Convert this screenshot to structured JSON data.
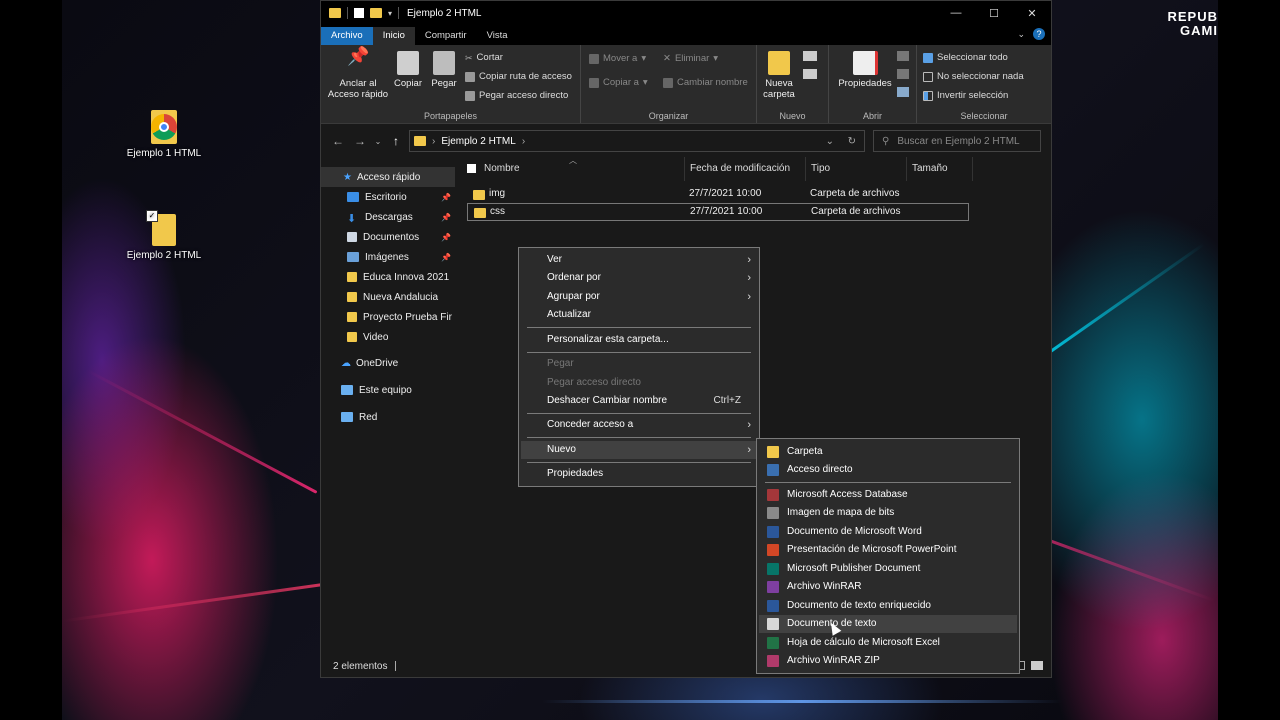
{
  "colors": {
    "accent": "#1a6fb9",
    "folder": "#f1c84b",
    "window_bg": "#191919",
    "ribbon_bg": "#2b2b2b",
    "menu_bg": "#2b2b2b"
  },
  "wallpaper_brand": [
    "REPUB",
    "GAMI"
  ],
  "desktop_icons": [
    {
      "label": "Ejemplo 1 HTML",
      "icon": "chrome-icon"
    },
    {
      "label": "Ejemplo 2 HTML",
      "icon": "folder-icon"
    }
  ],
  "window": {
    "title": "Ejemplo 2 HTML",
    "controls": {
      "minimize": "—",
      "maximize": "☐",
      "close": "✕"
    }
  },
  "ribbon_tabs": [
    "Archivo",
    "Inicio",
    "Compartir",
    "Vista"
  ],
  "ribbon": {
    "portapapeles": {
      "label": "Portapapeles",
      "anclar": "Anclar al Acceso rápido",
      "copiar": "Copiar",
      "pegar": "Pegar",
      "cortar": "Cortar",
      "copiar_ruta": "Copiar ruta de acceso",
      "pegar_acceso": "Pegar acceso directo"
    },
    "organizar": {
      "label": "Organizar",
      "mover": "Mover a",
      "copiar_a": "Copiar a",
      "eliminar": "Eliminar",
      "cambiar_nombre": "Cambiar nombre"
    },
    "nuevo": {
      "label": "Nuevo",
      "nueva_carpeta": "Nueva carpeta"
    },
    "abrir": {
      "label": "Abrir",
      "propiedades": "Propiedades"
    },
    "seleccionar": {
      "label": "Seleccionar",
      "todo": "Seleccionar todo",
      "nada": "No seleccionar nada",
      "invertir": "Invertir selección"
    }
  },
  "address": {
    "path": "Ejemplo 2 HTML",
    "search_placeholder": "Buscar en Ejemplo 2 HTML"
  },
  "nav": {
    "quick_access": "Acceso rápido",
    "pinned": [
      {
        "label": "Escritorio",
        "icon": "desktop-icon",
        "color": "#3a8ee6"
      },
      {
        "label": "Descargas",
        "icon": "download-icon",
        "color": "#3a8ee6"
      },
      {
        "label": "Documentos",
        "icon": "documents-icon",
        "color": "#cfd8e3"
      },
      {
        "label": "Imágenes",
        "icon": "pictures-icon",
        "color": "#6aa0d8"
      }
    ],
    "folders": [
      "Educa Innova 2021",
      "Nueva Andalucia",
      "Proyecto Prueba Fir",
      "Video"
    ],
    "onedrive": "OneDrive",
    "este_equipo": "Este equipo",
    "red": "Red"
  },
  "columns": [
    "Nombre",
    "Fecha de modificación",
    "Tipo",
    "Tamaño"
  ],
  "files": [
    {
      "name": "img",
      "date": "27/7/2021 10:00",
      "type": "Carpeta de archivos"
    },
    {
      "name": "css",
      "date": "27/7/2021 10:00",
      "type": "Carpeta de archivos"
    }
  ],
  "status": "2 elementos",
  "context_menu": {
    "ver": "Ver",
    "ordenar": "Ordenar por",
    "agrupar": "Agrupar por",
    "actualizar": "Actualizar",
    "personalizar": "Personalizar esta carpeta...",
    "pegar": "Pegar",
    "pegar_acceso": "Pegar acceso directo",
    "deshacer": "Deshacer Cambiar nombre",
    "deshacer_shortcut": "Ctrl+Z",
    "conceder": "Conceder acceso a",
    "nuevo": "Nuevo",
    "propiedades": "Propiedades"
  },
  "submenu_nuevo": [
    {
      "label": "Carpeta",
      "color": "#f1c84b"
    },
    {
      "label": "Acceso directo",
      "color": "#3a6fb0"
    },
    {
      "label": "Microsoft Access Database",
      "color": "#a4373a"
    },
    {
      "label": "Imagen de mapa de bits",
      "color": "#8a8a8a"
    },
    {
      "label": "Documento de Microsoft Word",
      "color": "#2b579a"
    },
    {
      "label": "Presentación de Microsoft PowerPoint",
      "color": "#d24726"
    },
    {
      "label": "Microsoft Publisher Document",
      "color": "#077568"
    },
    {
      "label": "Archivo WinRAR",
      "color": "#7e3fa0"
    },
    {
      "label": "Documento de texto enriquecido",
      "color": "#2b579a"
    },
    {
      "label": "Documento de texto",
      "color": "#d8d8d8"
    },
    {
      "label": "Hoja de cálculo de Microsoft Excel",
      "color": "#217346"
    },
    {
      "label": "Archivo WinRAR ZIP",
      "color": "#b03a6a"
    }
  ]
}
